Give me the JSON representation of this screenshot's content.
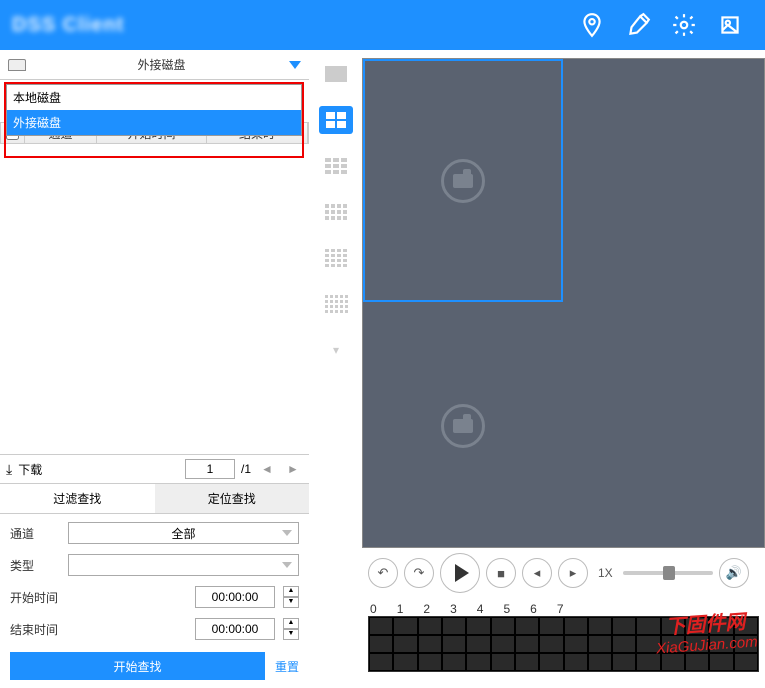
{
  "header": {
    "title": "DSS Client"
  },
  "disk": {
    "selected": "外接磁盘",
    "options": [
      "本地磁盘",
      "外接磁盘"
    ]
  },
  "table": {
    "headers": {
      "channel": "通道",
      "start": "开始时间",
      "end": "结束时"
    }
  },
  "download": {
    "label": "下载",
    "page": "1",
    "total": "/1"
  },
  "tabs": {
    "filter": "过滤查找",
    "locate": "定位查找"
  },
  "form": {
    "channel_label": "通道",
    "channel_value": "全部",
    "type_label": "类型",
    "type_value": "",
    "start_label": "开始时间",
    "start_value": "00:00:00",
    "end_label": "结束时间",
    "end_value": "00:00:00"
  },
  "actions": {
    "start": "开始查找",
    "reset": "重置"
  },
  "playback": {
    "speed": "1X"
  },
  "timeline": {
    "labels": [
      "0",
      "1",
      "2",
      "3",
      "4",
      "5",
      "6",
      "7"
    ]
  },
  "watermark": {
    "line1": "下固件网",
    "line2": "XiaGuJian.com"
  }
}
